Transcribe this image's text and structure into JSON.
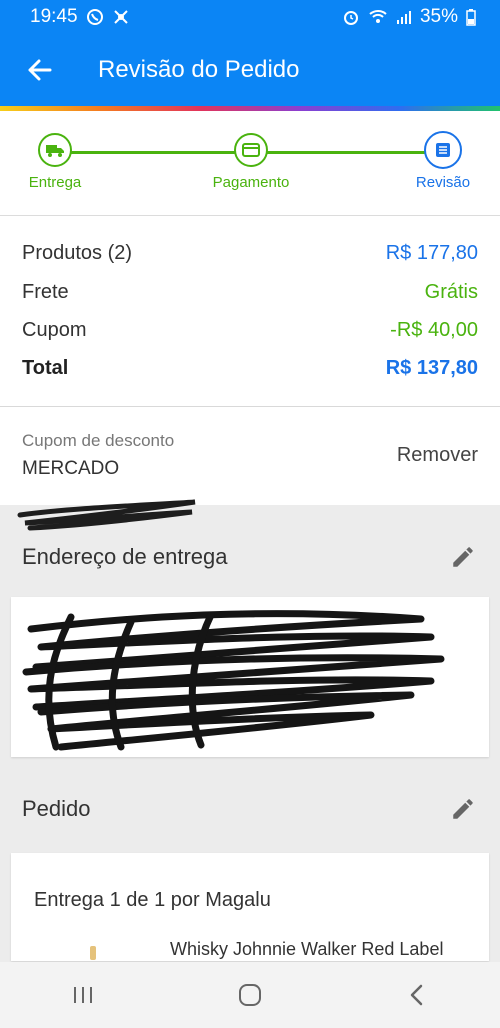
{
  "status_bar": {
    "time": "19:45",
    "battery": "35%",
    "icons_left": [
      "whatsapp-icon",
      "settings-app-icon"
    ],
    "icons_right": [
      "alarm-icon",
      "wifi-icon",
      "signal-icon",
      "battery-icon"
    ]
  },
  "app_bar": {
    "title": "Revisão do Pedido",
    "back_icon": "arrow-back-icon"
  },
  "stepper": {
    "steps": [
      {
        "label": "Entrega",
        "icon": "truck-icon",
        "state": "done"
      },
      {
        "label": "Pagamento",
        "icon": "card-icon",
        "state": "done"
      },
      {
        "label": "Revisão",
        "icon": "list-icon",
        "state": "active"
      }
    ]
  },
  "summary": {
    "rows": [
      {
        "label": "Produtos (2)",
        "value": "R$ 177,80"
      },
      {
        "label": "Frete",
        "value": "Grátis"
      },
      {
        "label": "Cupom",
        "value": "-R$ 40,00"
      },
      {
        "label": "Total",
        "value": "R$ 137,80"
      }
    ]
  },
  "coupon": {
    "label": "Cupom de desconto",
    "code": "MERCADO",
    "remove_label": "Remover"
  },
  "address_section": {
    "title": "Endereço de entrega",
    "edit_icon": "pencil-icon"
  },
  "order_section": {
    "title": "Pedido",
    "edit_icon": "pencil-icon",
    "delivery_title": "Entrega 1 de 1 por Magalu",
    "product_name": "Whisky Johnnie Walker Red Label"
  },
  "colors": {
    "primary": "#0b85f5",
    "green": "#4ab30f",
    "blue_text": "#1a73e8"
  },
  "nav_bar": {
    "icons": [
      "recent-apps-icon",
      "home-icon",
      "back-icon"
    ]
  }
}
